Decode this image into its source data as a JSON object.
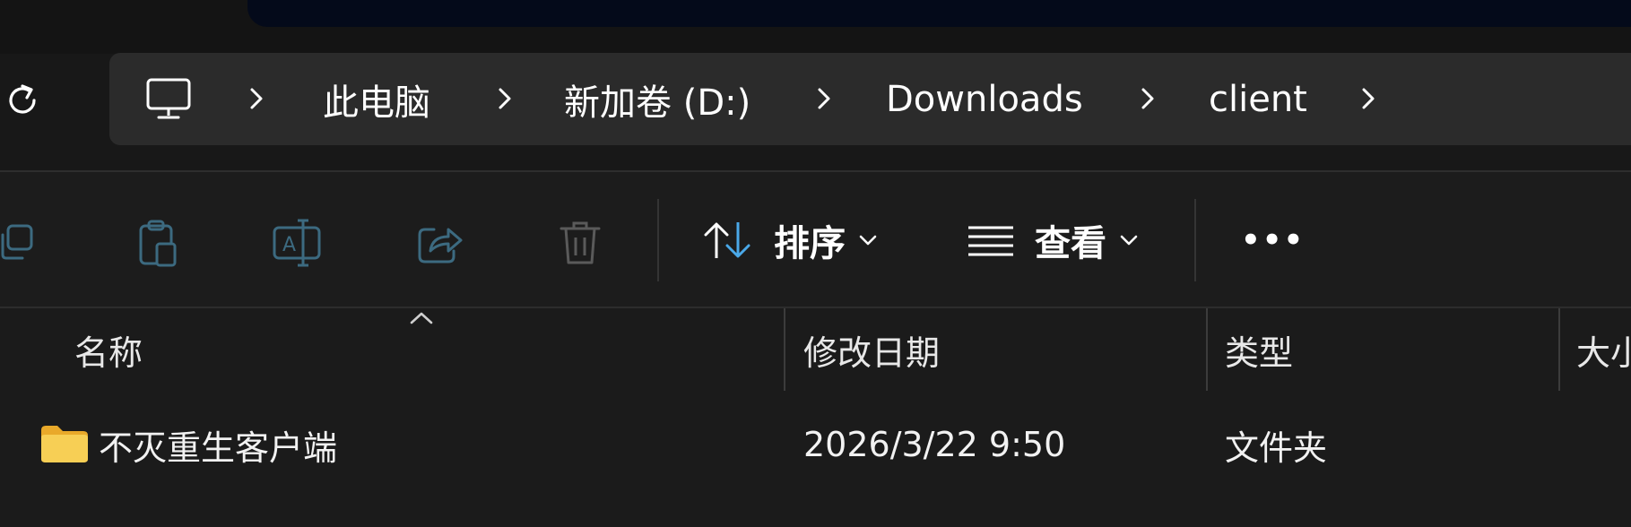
{
  "breadcrumb": {
    "items": [
      {
        "label": "此电脑"
      },
      {
        "label": "新加卷 (D:)"
      },
      {
        "label": "Downloads"
      },
      {
        "label": "client"
      }
    ]
  },
  "toolbar": {
    "sort_label": "排序",
    "view_label": "查看",
    "more_label": "•••"
  },
  "columns": {
    "name": "名称",
    "modified": "修改日期",
    "type": "类型",
    "size": "大小"
  },
  "files": [
    {
      "name": "不灭重生客户端",
      "modified": "2026/3/22 9:50",
      "type": "文件夹",
      "icon": "folder-icon"
    }
  ],
  "colors": {
    "background": "#1b1b1b",
    "address_bar": "#2b2b2b",
    "folder": "#f4c542",
    "accent_blue": "#4aa8e8"
  }
}
